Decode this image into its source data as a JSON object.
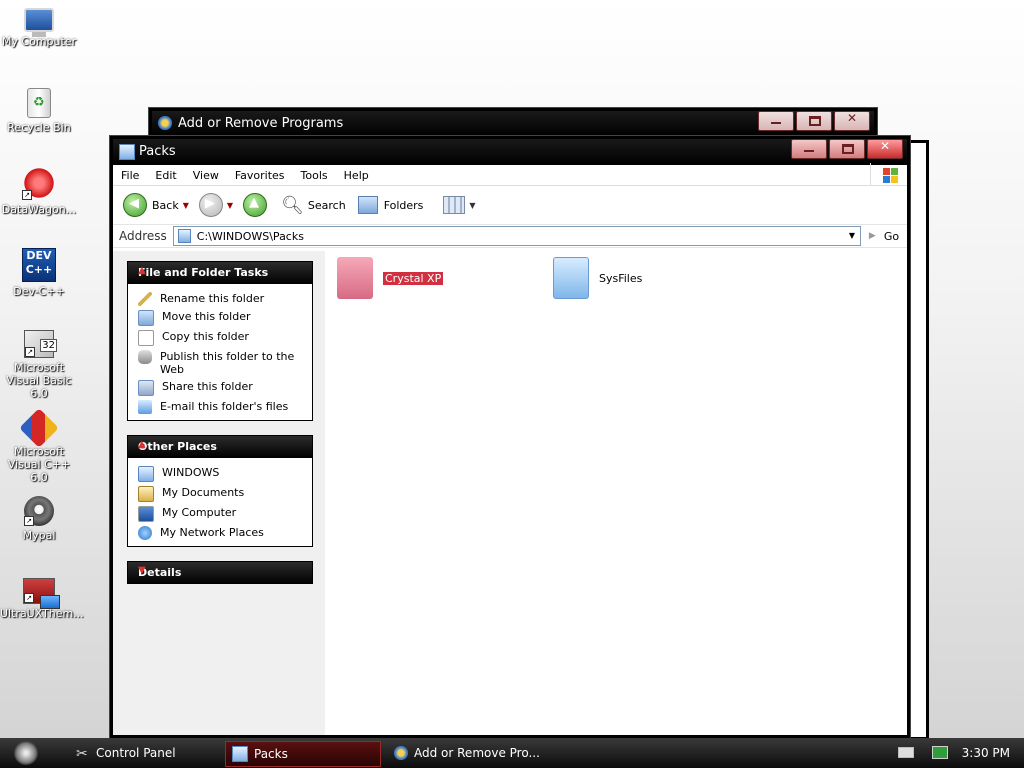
{
  "desktop": {
    "icons": [
      {
        "label": "My Computer"
      },
      {
        "label": "Recycle Bin"
      },
      {
        "label": "DataWagon..."
      },
      {
        "label": "Dev-C++"
      },
      {
        "label": "Microsoft Visual Basic 6.0"
      },
      {
        "label": "Microsoft Visual C++ 6.0"
      },
      {
        "label": "Mypal"
      },
      {
        "label": "UltraUXThem..."
      }
    ],
    "vb_badge": "32",
    "dev_logo": "DEV"
  },
  "windows": {
    "add_remove": {
      "title": "Add or Remove Programs",
      "icon": "add-remove-programs-icon"
    },
    "packs": {
      "title": "Packs",
      "menu": [
        "File",
        "Edit",
        "View",
        "Favorites",
        "Tools",
        "Help"
      ],
      "toolbar": {
        "back": "Back",
        "search": "Search",
        "folders": "Folders"
      },
      "address": {
        "label": "Address",
        "value": "C:\\WINDOWS\\Packs",
        "go": "Go"
      },
      "file_tasks": {
        "title": "File and Folder Tasks",
        "items": [
          "Rename this folder",
          "Move this folder",
          "Copy this folder",
          "Publish this folder to the Web",
          "Share this folder",
          "E-mail this folder's files"
        ]
      },
      "other_places": {
        "title": "Other Places",
        "items": [
          "WINDOWS",
          "My Documents",
          "My Computer",
          "My Network Places"
        ]
      },
      "details": {
        "title": "Details"
      },
      "files": [
        {
          "name": "Crystal XP",
          "selected": true
        },
        {
          "name": "SysFiles",
          "selected": false
        }
      ]
    }
  },
  "taskbar": {
    "tasks": [
      "Control Panel",
      "Packs",
      "Add or Remove Pro..."
    ],
    "active_task": "Packs",
    "clock": "3:30 PM"
  },
  "colors": {
    "selection": "#d03040",
    "titlebar": "#000000",
    "close_button": "#c82d2d"
  }
}
